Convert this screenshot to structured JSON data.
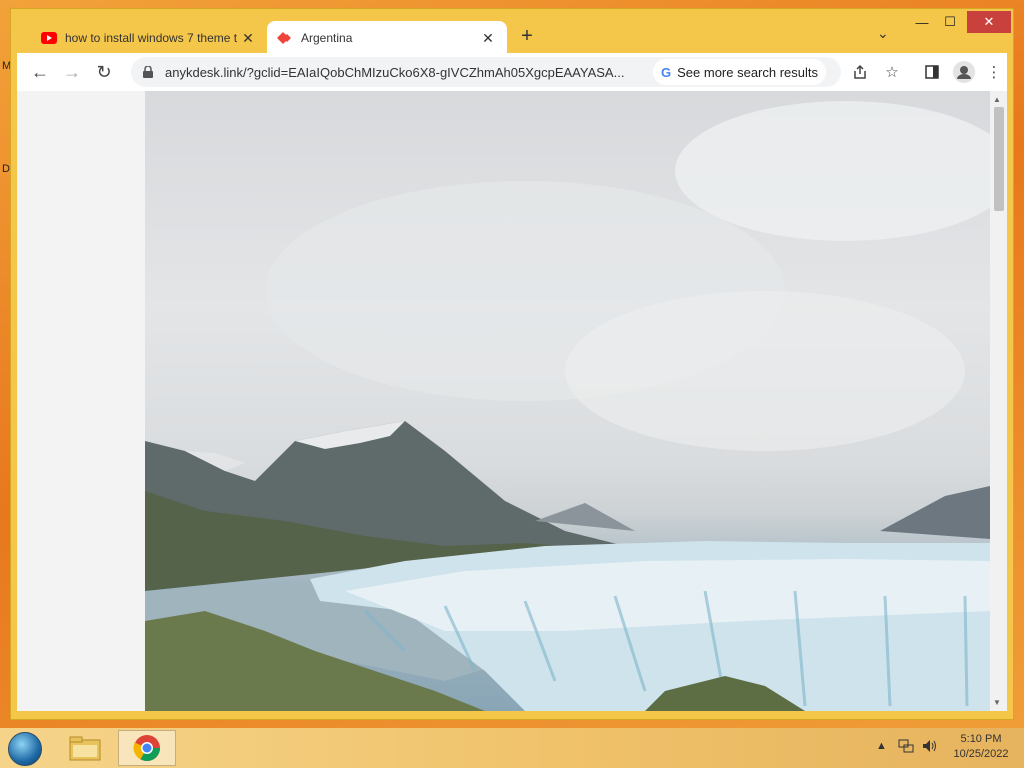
{
  "desktop": {
    "letters": [
      "M",
      "D"
    ]
  },
  "browser": {
    "tabs": [
      {
        "title": "how to install windows 7 theme t",
        "favicon": "youtube-icon",
        "active": false
      },
      {
        "title": "Argentina",
        "favicon": "anydesk-icon",
        "active": true
      }
    ],
    "new_tab_symbol": "+",
    "tab_search_symbol": "⌄",
    "window_controls": {
      "minimize": "—",
      "maximize": "☐",
      "close": "✕"
    },
    "toolbar": {
      "back": "←",
      "forward": "→",
      "reload": "↻",
      "url": "anykdesk.link/?gclid=EAIaIQobChMIzuCko6X8-gIVCZhmAh05XgcpEAAYASA...",
      "search_chip": "See more search results",
      "search_chip_logo": "G"
    }
  },
  "page": {
    "hero_image": "glacier-landscape"
  },
  "taskbar": {
    "apps": [
      "file-explorer-icon",
      "chrome-icon"
    ],
    "tray_arrow": "▲",
    "time": "5:10 PM",
    "date": "10/25/2022"
  },
  "colors": {
    "window_frame": "#f4c64a",
    "close_button": "#c9413d",
    "taskbar": "#f0c26a"
  }
}
